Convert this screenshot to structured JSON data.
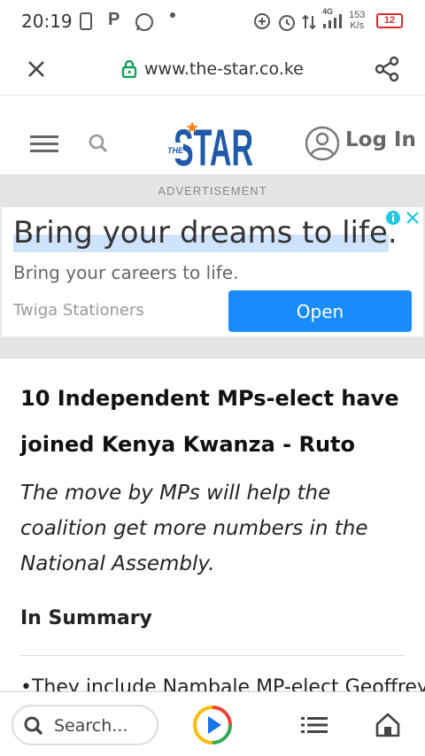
{
  "status_bar": {
    "time": "20:19",
    "network": "4G",
    "speed_value": "153",
    "speed_unit": "K/s",
    "battery": "12"
  },
  "browser": {
    "url": "www.the-star.co.ke"
  },
  "site": {
    "logo_prefix": "THE",
    "logo_main": "STAR",
    "login_label": "Log In"
  },
  "ad": {
    "label": "ADVERTISEMENT",
    "headline": "Bring your dreams to life.",
    "subline": "Bring your careers to life.",
    "advertiser": "Twiga Stationers",
    "cta": "Open"
  },
  "article": {
    "title_line1": "10 Independent MPs-elect have",
    "title_line2": "joined Kenya Kwanza - Ruto",
    "lede": "The move by MPs will help the coalition get more numbers in the National Assembly.",
    "summary_heading": "In Summary",
    "bullet_1": "•They include Nambale MP-elect Geoffrey"
  },
  "bottom_bar": {
    "search_placeholder": "Search..."
  },
  "colors": {
    "brand_blue": "#1e5aa8",
    "accent_orange": "#f5821f",
    "ad_button": "#1a8cff",
    "secure_green": "#0f9d58",
    "battery_red": "#d32f2f"
  },
  "icons": [
    "close-icon",
    "lock-icon",
    "share-icon",
    "menu-icon",
    "search-icon",
    "user-icon",
    "adchoices-icon",
    "ad-close-icon",
    "play-icon",
    "list-icon",
    "home-icon"
  ]
}
